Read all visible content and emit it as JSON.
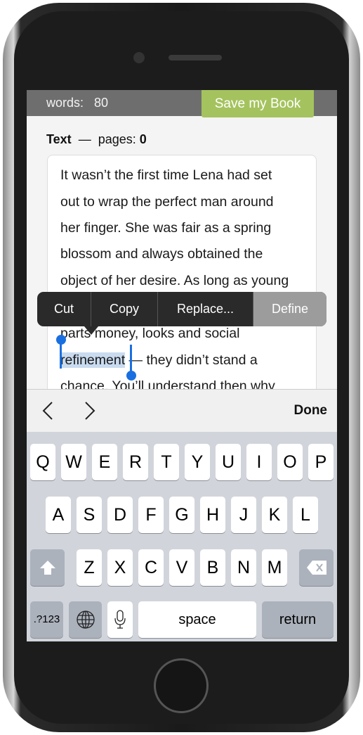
{
  "header": {
    "words_label": "words:",
    "words_count": "80",
    "save_button": "Save my Book"
  },
  "section": {
    "title": "Text",
    "dash": "—",
    "pages_label": "pages:",
    "pages_value": "0"
  },
  "text_lines": [
    "It wasn’t the first time Lena had set",
    "out to wrap the perfect man around",
    "her finger. She was fair as a spring",
    "blossom and always obtained the",
    "object of her desire. As long as young",
    "parts money, looks and social",
    "refinement",
    " — they didn’t stand a",
    "chance. You’ll understand then why"
  ],
  "edit_menu": [
    "Cut",
    "Copy",
    "Replace...",
    "Define"
  ],
  "toolbar": {
    "prev": "‹",
    "next": "›",
    "done": "Done"
  },
  "keyboard": {
    "row1": [
      "Q",
      "W",
      "E",
      "R",
      "T",
      "Y",
      "U",
      "I",
      "O",
      "P"
    ],
    "row2": [
      "A",
      "S",
      "D",
      "F",
      "G",
      "H",
      "J",
      "K",
      "L"
    ],
    "row3": [
      "Z",
      "X",
      "C",
      "V",
      "B",
      "N",
      "M"
    ],
    "numbers": ".?123",
    "space": "space",
    "return": "return"
  },
  "colors": {
    "save": "#a4c35e",
    "selection": "#c9dbef",
    "handle": "#1a6fe0"
  }
}
